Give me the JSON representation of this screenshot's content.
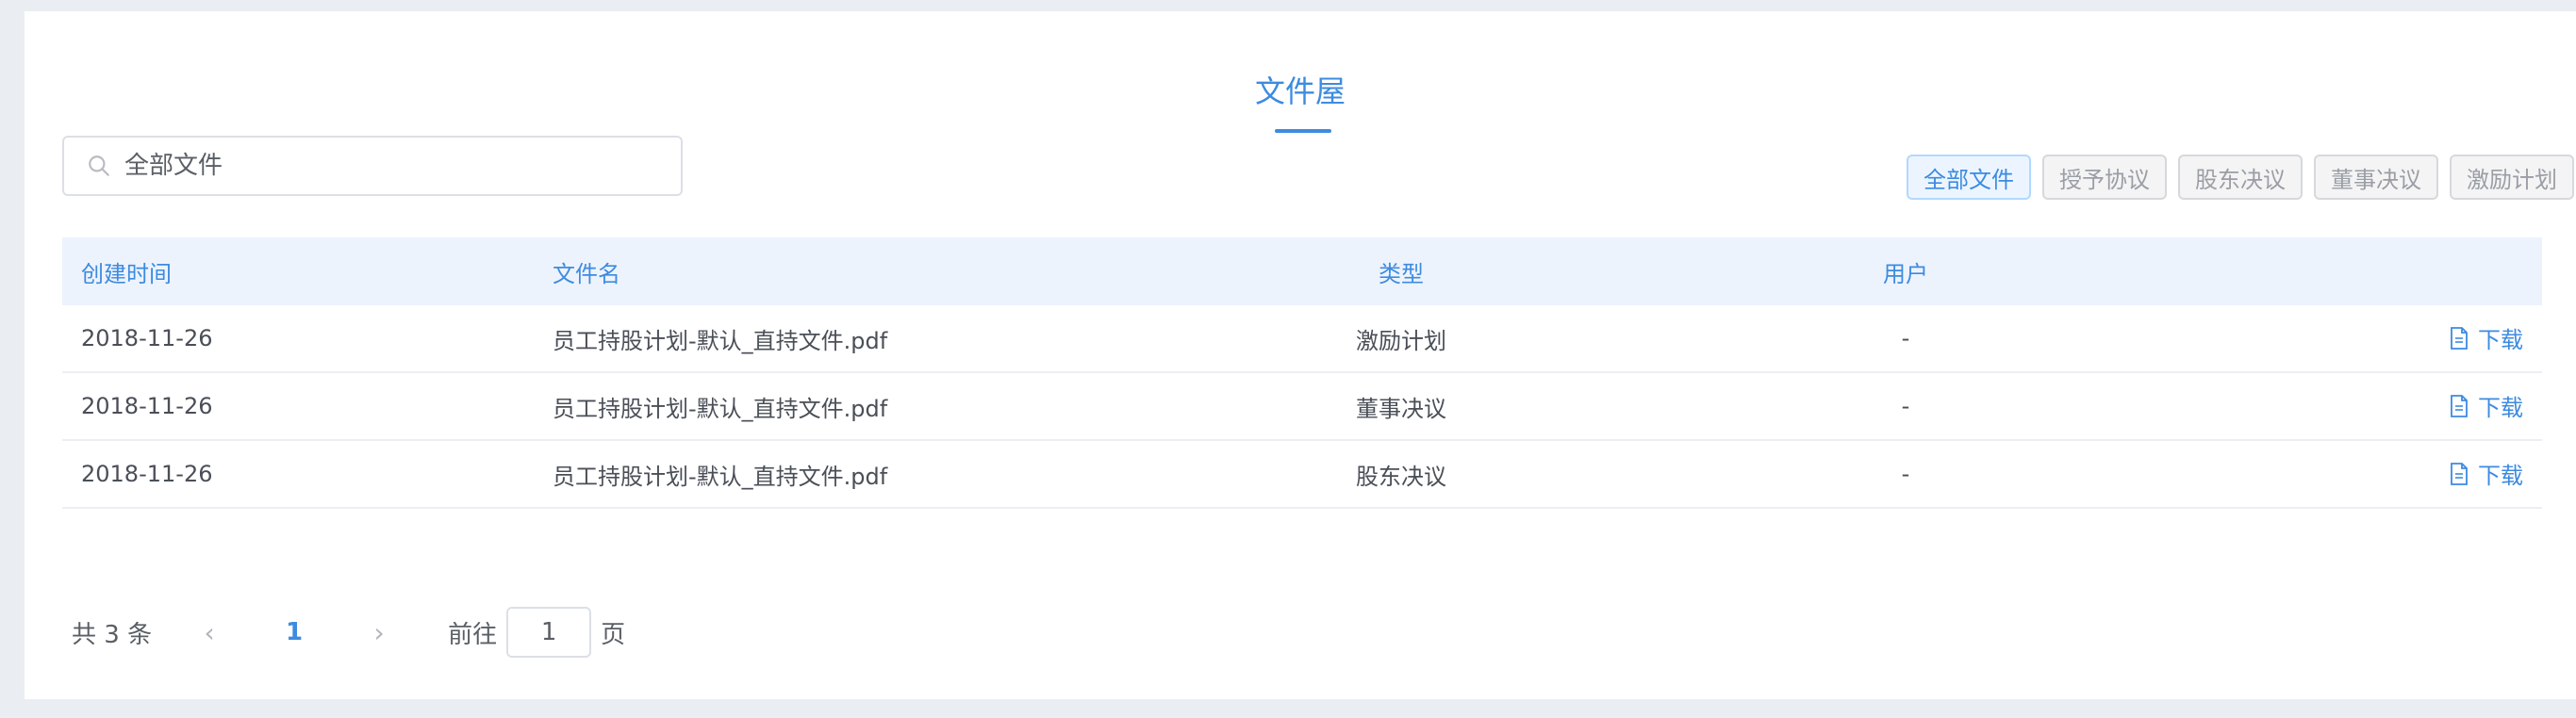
{
  "page": {
    "title": "文件屋"
  },
  "search": {
    "placeholder": "全部文件"
  },
  "filters": [
    "全部文件",
    "授予协议",
    "股东决议",
    "董事决议",
    "激励计划"
  ],
  "table": {
    "headers": [
      "创建时间",
      "文件名",
      "类型",
      "用户",
      ""
    ],
    "rows": [
      {
        "date": "2018-11-26",
        "name": "员工持股计划-默认_直持文件.pdf",
        "type": "激励计划",
        "user": "-",
        "action": "下载"
      },
      {
        "date": "2018-11-26",
        "name": "员工持股计划-默认_直持文件.pdf",
        "type": "董事决议",
        "user": "-",
        "action": "下载"
      },
      {
        "date": "2018-11-26",
        "name": "员工持股计划-默认_直持文件.pdf",
        "type": "股东决议",
        "user": "-",
        "action": "下载"
      }
    ]
  },
  "pagination": {
    "total_text": "共 3 条",
    "current_page": "1",
    "goto_label": "前往",
    "goto_value": "1",
    "unit_label": "页"
  },
  "colors": {
    "accent": "#3d8be0",
    "header_bg": "#edf3fd"
  }
}
